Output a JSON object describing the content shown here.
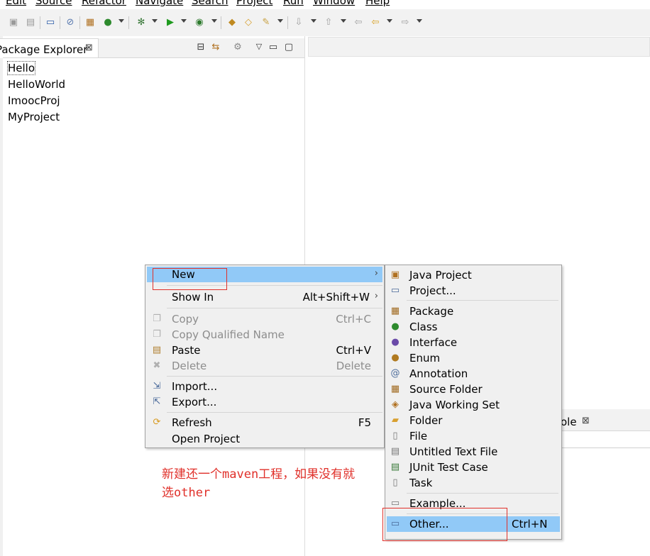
{
  "menubar": {
    "items": [
      {
        "label": "Edit"
      },
      {
        "label": "Source"
      },
      {
        "label": "Refactor"
      },
      {
        "label": "Navigate"
      },
      {
        "label": "Search"
      },
      {
        "label": "Project"
      },
      {
        "label": "Run"
      },
      {
        "label": "Window"
      },
      {
        "label": "Help"
      }
    ]
  },
  "package_explorer": {
    "title": "Package Explorer",
    "close_glyph": "⊠",
    "projects": [
      {
        "label": "Hello"
      },
      {
        "label": "HelloWorld"
      },
      {
        "label": "ImoocProj"
      },
      {
        "label": "MyProject"
      }
    ]
  },
  "console": {
    "label": "ole",
    "close_glyph": "⊠"
  },
  "context_menu": {
    "items": [
      {
        "label": "New",
        "shortcut": "",
        "icon": "none",
        "submenu_arrow": "›"
      },
      {
        "label": "Show In",
        "shortcut": "Alt+Shift+W",
        "icon": "none",
        "submenu_arrow": "›"
      },
      {
        "label": "Copy",
        "shortcut": "Ctrl+C",
        "icon": "copy-icon",
        "disabled": true
      },
      {
        "label": "Copy Qualified Name",
        "shortcut": "",
        "icon": "copy-qualified-icon",
        "disabled": true
      },
      {
        "label": "Paste",
        "shortcut": "Ctrl+V",
        "icon": "paste-icon"
      },
      {
        "label": "Delete",
        "shortcut": "Delete",
        "icon": "delete-icon",
        "disabled": true
      },
      {
        "label": "Import...",
        "shortcut": "",
        "icon": "import-icon"
      },
      {
        "label": "Export...",
        "shortcut": "",
        "icon": "export-icon"
      },
      {
        "label": "Refresh",
        "shortcut": "F5",
        "icon": "refresh-icon"
      },
      {
        "label": "Open Project",
        "shortcut": "",
        "icon": "none"
      }
    ]
  },
  "new_submenu": {
    "items": [
      {
        "label": "Java Project",
        "icon": "java-project-icon"
      },
      {
        "label": "Project...",
        "icon": "project-icon"
      },
      {
        "label": "Package",
        "icon": "package-icon"
      },
      {
        "label": "Class",
        "icon": "class-icon"
      },
      {
        "label": "Interface",
        "icon": "interface-icon"
      },
      {
        "label": "Enum",
        "icon": "enum-icon"
      },
      {
        "label": "Annotation",
        "icon": "annotation-icon"
      },
      {
        "label": "Source Folder",
        "icon": "source-folder-icon"
      },
      {
        "label": "Java Working Set",
        "icon": "working-set-icon"
      },
      {
        "label": "Folder",
        "icon": "folder-icon"
      },
      {
        "label": "File",
        "icon": "file-icon"
      },
      {
        "label": "Untitled Text File",
        "icon": "text-file-icon"
      },
      {
        "label": "JUnit Test Case",
        "icon": "junit-icon"
      },
      {
        "label": "Task",
        "icon": "task-icon"
      },
      {
        "label": "Example...",
        "icon": "example-icon"
      },
      {
        "label": "Other...",
        "shortcut": "Ctrl+N",
        "icon": "other-icon"
      }
    ]
  },
  "annotation": {
    "line1": "新建还一个maven工程，如果没有就",
    "line2": "选other"
  },
  "colors": {
    "highlight": "#91c9f7",
    "annotation_red": "#e0302a",
    "menu_bg": "#f0f0f0"
  }
}
